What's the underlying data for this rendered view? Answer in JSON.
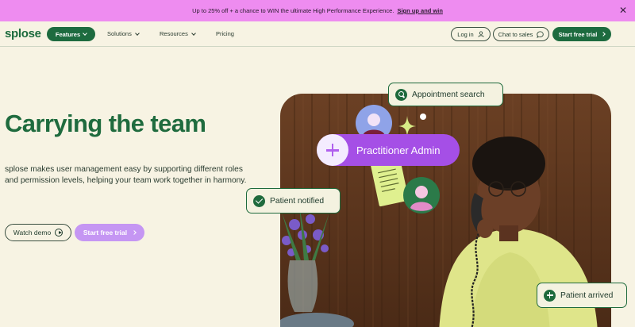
{
  "promo": {
    "text": "Up to 25% off + a chance to WIN the ultimate High Performance Experience.",
    "link": "Sign up and win"
  },
  "nav": {
    "logo": "splose",
    "features": "Features",
    "solutions": "Solutions",
    "resources": "Resources",
    "pricing": "Pricing",
    "login": "Log in",
    "chat": "Chat to sales",
    "trial": "Start free trial"
  },
  "hero": {
    "title": "Carrying the team",
    "body": "splose makes user management easy by supporting different roles and permission levels, helping your team work together in harmony.",
    "watch_demo": "Watch demo",
    "trial": "Start free trial"
  },
  "illustration": {
    "appointment": "Appointment search",
    "practitioner": "Practitioner Admin",
    "notified": "Patient notified",
    "arrived": "Patient arrived"
  },
  "colors": {
    "brand_green": "#1d6b3f",
    "promo_pink": "#ee8cf0",
    "cta_purple": "#c596f3",
    "background": "#f7f3e3"
  }
}
